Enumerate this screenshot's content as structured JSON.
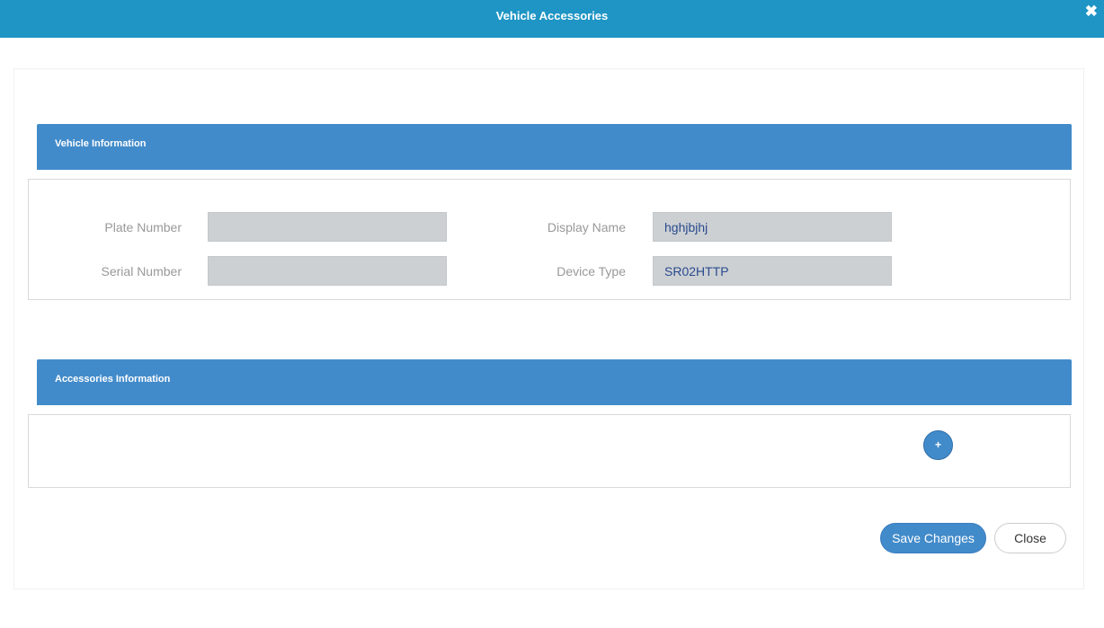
{
  "modal": {
    "title": "Vehicle Accessories",
    "close_icon": "close-icon"
  },
  "vehicle_info": {
    "title": "Vehicle Information",
    "fields": {
      "plate_number": {
        "label": "Plate Number",
        "value": ""
      },
      "display_name": {
        "label": "Display Name",
        "value": "hghjbjhj"
      },
      "serial_number": {
        "label": "Serial Number",
        "value": ""
      },
      "device_type": {
        "label": "Device Type",
        "value": "SR02HTTP"
      }
    }
  },
  "accessories_info": {
    "title": "Accessories Information",
    "add_label": "+"
  },
  "footer": {
    "save_label": "Save Changes",
    "close_label": "Close"
  },
  "colors": {
    "header": "#1e95c4",
    "section_header": "#428bca",
    "input_bg": "#ccd0d3",
    "input_text": "#2a4a8e"
  }
}
